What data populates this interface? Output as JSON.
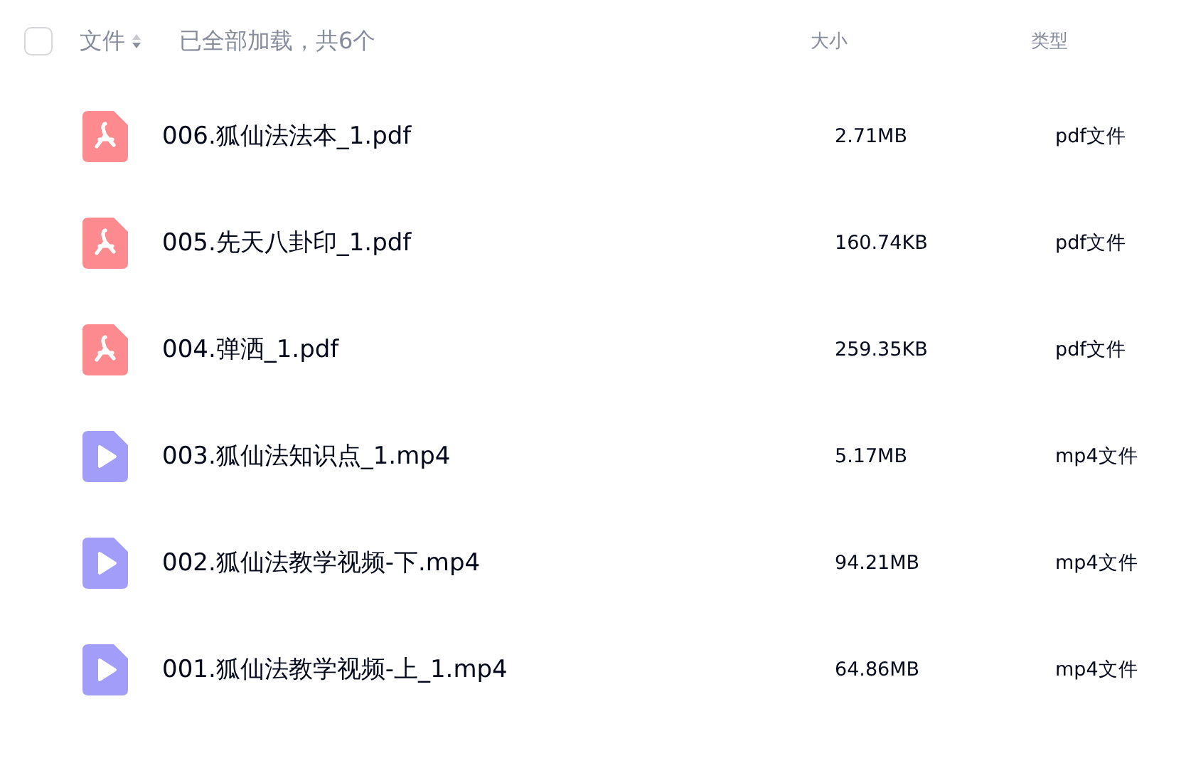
{
  "header": {
    "select_all": {
      "checked": false
    },
    "name_label": "文件",
    "status": "已全部加载，共6个",
    "size_label": "大小",
    "type_label": "类型"
  },
  "files": [
    {
      "kind": "pdf",
      "name": "006.狐仙法法本_1.pdf",
      "size": "2.71MB",
      "type": "pdf文件"
    },
    {
      "kind": "pdf",
      "name": "005.先天八卦印_1.pdf",
      "size": "160.74KB",
      "type": "pdf文件"
    },
    {
      "kind": "pdf",
      "name": "004.弹洒_1.pdf",
      "size": "259.35KB",
      "type": "pdf文件"
    },
    {
      "kind": "video",
      "name": "003.狐仙法知识点_1.mp4",
      "size": "5.17MB",
      "type": "mp4文件"
    },
    {
      "kind": "video",
      "name": "002.狐仙法教学视频-下.mp4",
      "size": "94.21MB",
      "type": "mp4文件"
    },
    {
      "kind": "video",
      "name": "001.狐仙法教学视频-上_1.mp4",
      "size": "64.86MB",
      "type": "mp4文件"
    }
  ]
}
